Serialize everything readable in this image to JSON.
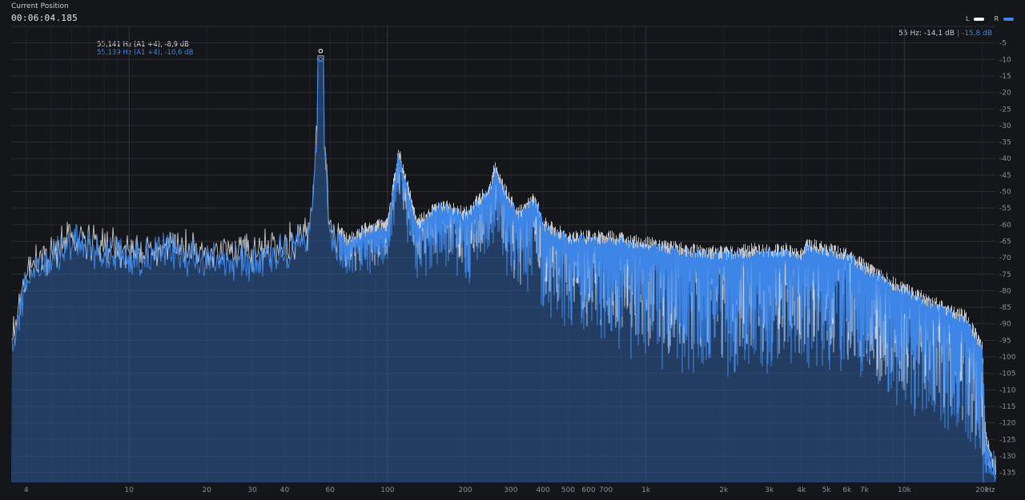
{
  "header": {
    "position_label": "Current Position",
    "position_time": "00:06:04.185"
  },
  "legend": [
    {
      "label": "L",
      "color": "#ffffff"
    },
    {
      "label": "R",
      "color": "#3d86e8"
    }
  ],
  "readout": {
    "freq": "55 Hz:",
    "left_value": "-14,1 dB",
    "separator": "|",
    "right_value": "-15,8 dB"
  },
  "peak_tooltip": {
    "left": "55,141 Hz (A1 +4), -8,9 dB",
    "right": "55,139 Hz (A1 +4), -10,6 dB"
  },
  "colors": {
    "background": "#141619",
    "grid": "#2a2e34",
    "left_channel": "#e4e6ea",
    "right_channel": "#3d86e8",
    "right_fill": "#2f5f9e"
  },
  "chart_data": {
    "type": "line",
    "title": "",
    "xlabel": "",
    "ylabel": "",
    "x_scale": "log",
    "xlim": [
      3.5,
      22500
    ],
    "ylim": [
      -138,
      0
    ],
    "grid": true,
    "legend_position": "top-right",
    "x_unit_label": "Hz",
    "x_ticks": [
      {
        "value": 4,
        "label": "4"
      },
      {
        "value": 10,
        "label": "10"
      },
      {
        "value": 20,
        "label": "20"
      },
      {
        "value": 30,
        "label": "30"
      },
      {
        "value": 40,
        "label": "40"
      },
      {
        "value": 60,
        "label": "60"
      },
      {
        "value": 100,
        "label": "100"
      },
      {
        "value": 200,
        "label": "200"
      },
      {
        "value": 300,
        "label": "300"
      },
      {
        "value": 400,
        "label": "400"
      },
      {
        "value": 500,
        "label": "500"
      },
      {
        "value": 600,
        "label": "600"
      },
      {
        "value": 700,
        "label": "700"
      },
      {
        "value": 1000,
        "label": "1k"
      },
      {
        "value": 2000,
        "label": "2k"
      },
      {
        "value": 3000,
        "label": "3k"
      },
      {
        "value": 4000,
        "label": "4k"
      },
      {
        "value": 5000,
        "label": "5k"
      },
      {
        "value": 6000,
        "label": "6k"
      },
      {
        "value": 7000,
        "label": "7k"
      },
      {
        "value": 10000,
        "label": "10k"
      },
      {
        "value": 20000,
        "label": "20k"
      }
    ],
    "y_ticks": [
      {
        "value": -5,
        "label": "-5"
      },
      {
        "value": -10,
        "label": "-10"
      },
      {
        "value": -15,
        "label": "-15"
      },
      {
        "value": -20,
        "label": "-20"
      },
      {
        "value": -25,
        "label": "-25"
      },
      {
        "value": -30,
        "label": "-30"
      },
      {
        "value": -35,
        "label": "-35"
      },
      {
        "value": -40,
        "label": "-40"
      },
      {
        "value": -45,
        "label": "-45"
      },
      {
        "value": -50,
        "label": "-50"
      },
      {
        "value": -55,
        "label": "-55"
      },
      {
        "value": -60,
        "label": "-60"
      },
      {
        "value": -65,
        "label": "-65"
      },
      {
        "value": -70,
        "label": "-70"
      },
      {
        "value": -75,
        "label": "-75"
      },
      {
        "value": -80,
        "label": "-80"
      },
      {
        "value": -85,
        "label": "-85"
      },
      {
        "value": -90,
        "label": "-90"
      },
      {
        "value": -95,
        "label": "-95"
      },
      {
        "value": -100,
        "label": "-100"
      },
      {
        "value": -105,
        "label": "-105"
      },
      {
        "value": -110,
        "label": "-110"
      },
      {
        "value": -115,
        "label": "-115"
      },
      {
        "value": -120,
        "label": "-120"
      },
      {
        "value": -125,
        "label": "-125"
      },
      {
        "value": -130,
        "label": "-130"
      },
      {
        "value": -135,
        "label": "-135"
      }
    ],
    "series": [
      {
        "name": "L",
        "envelope": {
          "x": [
            3.6,
            4,
            6,
            10,
            15,
            20,
            30,
            40,
            50,
            55,
            60,
            70,
            80,
            100,
            110,
            130,
            160,
            200,
            250,
            260,
            280,
            320,
            370,
            400,
            500,
            700,
            1000,
            1500,
            2000,
            2600,
            3000,
            3500,
            4000,
            4200,
            5000,
            6000,
            7000,
            10000,
            13000,
            17000,
            20000,
            20500,
            22000
          ],
          "y": [
            -86,
            -68,
            -57,
            -62,
            -60,
            -63,
            -62,
            -60,
            -56,
            -8.9,
            -57,
            -63,
            -60,
            -58,
            -36,
            -58,
            -52,
            -55,
            -47,
            -40,
            -47,
            -55,
            -50,
            -58,
            -62,
            -62,
            -64,
            -66,
            -67,
            -66,
            -66,
            -66,
            -67,
            -64,
            -66,
            -67,
            -71,
            -78,
            -82,
            -86,
            -95,
            -120,
            -134
          ]
        },
        "peaks": [
          {
            "x": 55.141,
            "y": -8.9
          }
        ]
      },
      {
        "name": "R",
        "envelope": {
          "x": [
            3.6,
            4,
            6,
            10,
            15,
            20,
            30,
            40,
            50,
            55,
            60,
            70,
            80,
            100,
            110,
            130,
            160,
            200,
            250,
            260,
            280,
            320,
            370,
            400,
            500,
            700,
            1000,
            1500,
            2000,
            2600,
            3000,
            3500,
            4000,
            4200,
            5000,
            6000,
            7000,
            10000,
            13000,
            17000,
            20000,
            20500,
            22000
          ],
          "y": [
            -86,
            -68,
            -57,
            -62,
            -60,
            -63,
            -62,
            -60,
            -56,
            -10.6,
            -57,
            -63,
            -60,
            -58,
            -36,
            -58,
            -52,
            -55,
            -47,
            -40,
            -47,
            -55,
            -50,
            -58,
            -62,
            -62,
            -64,
            -66,
            -67,
            -66,
            -66,
            -66,
            -67,
            -64,
            -66,
            -67,
            -71,
            -78,
            -82,
            -86,
            -95,
            -120,
            -134
          ]
        },
        "peaks": [
          {
            "x": 55.139,
            "y": -10.6
          }
        ]
      }
    ]
  }
}
